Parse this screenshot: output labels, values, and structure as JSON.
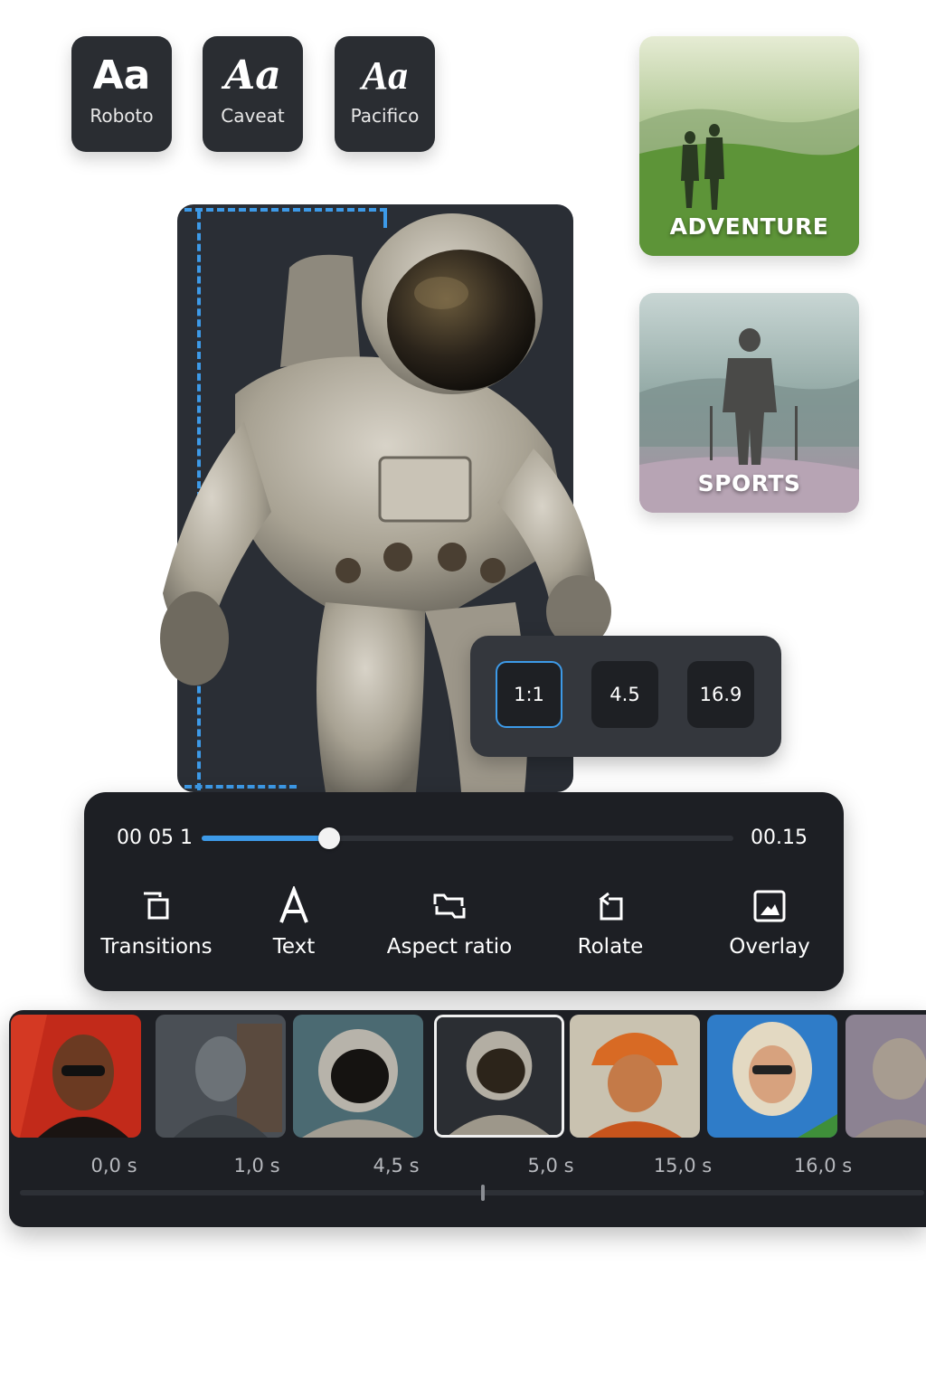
{
  "fonts": [
    {
      "sample": "Aa",
      "name": "Roboto"
    },
    {
      "sample": "Aa",
      "name": "Caveat"
    },
    {
      "sample": "Aa",
      "name": "Pacifico"
    }
  ],
  "categories": [
    {
      "label": "ADVENTURE"
    },
    {
      "label": "SPORTS"
    }
  ],
  "aspect_ratios": {
    "options": [
      "1:1",
      "4.5",
      "16.9"
    ],
    "selected": "1:1"
  },
  "playback": {
    "current_time": "00 05 1",
    "total_time": "00.15",
    "progress_fraction": 0.24
  },
  "tools": [
    {
      "label": "Transitions",
      "icon": "transitions-icon"
    },
    {
      "label": "Text",
      "icon": "text-icon"
    },
    {
      "label": "Aspect ratio",
      "icon": "aspect-ratio-icon"
    },
    {
      "label": "Rolate",
      "icon": "rotate-icon"
    },
    {
      "label": "Overlay",
      "icon": "overlay-icon"
    }
  ],
  "timeline": {
    "timestamps": [
      "0,0 s",
      "1,0 s",
      "4,5 s",
      "5,0 s",
      "15,0 s",
      "16,0 s"
    ],
    "selected_clip_index": 3,
    "scrub_fraction": 0.51
  },
  "colors": {
    "accent": "#3d9ae8",
    "panel": "#1d1f24",
    "card": "#2a2d32"
  }
}
